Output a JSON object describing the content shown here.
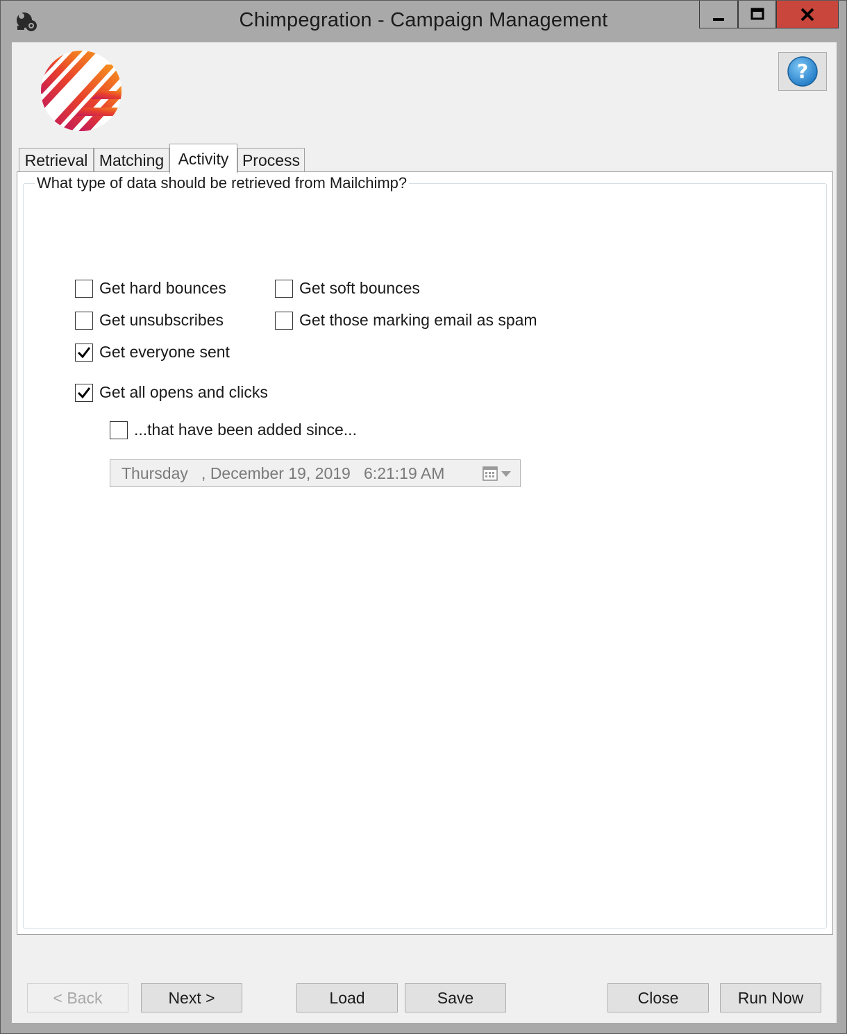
{
  "window": {
    "title": "Chimpegration - Campaign Management"
  },
  "tabs": [
    {
      "label": "Retrieval"
    },
    {
      "label": "Matching"
    },
    {
      "label": "Activity",
      "active": true
    },
    {
      "label": "Process"
    }
  ],
  "activity": {
    "group_title": "What type of data should be retrieved from Mailchimp?",
    "hard_bounces": {
      "label": "Get hard bounces",
      "checked": false
    },
    "soft_bounces": {
      "label": "Get soft bounces",
      "checked": false
    },
    "unsubscribes": {
      "label": "Get unsubscribes",
      "checked": false
    },
    "spam": {
      "label": "Get those marking email as spam",
      "checked": false
    },
    "everyone_sent": {
      "label": "Get everyone sent",
      "checked": true
    },
    "opens_clicks": {
      "label": "Get all opens and clicks",
      "checked": true
    },
    "added_since": {
      "label": "...that have been added since...",
      "checked": false
    },
    "date_value": "Thursday   , December 19, 2019   6:21:19 AM"
  },
  "buttons": {
    "back": "< Back",
    "next": "Next >",
    "load": "Load",
    "save": "Save",
    "close": "Close",
    "run_now": "Run Now"
  },
  "icons": {
    "app": "chimp-app-icon",
    "help": "help-icon",
    "calendar": "calendar-icon"
  },
  "colors": {
    "close_button": "#c9463d",
    "help_blue": "#2e8fd4",
    "logo_gradient_start": "#d81f3c",
    "logo_gradient_end": "#f7941d"
  }
}
